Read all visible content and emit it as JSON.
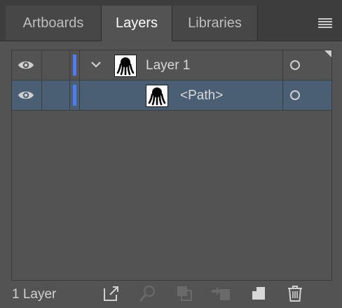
{
  "tabs": [
    {
      "label": "Artboards",
      "active": false
    },
    {
      "label": "Layers",
      "active": true
    },
    {
      "label": "Libraries",
      "active": false
    }
  ],
  "panel_menu_icon": "hamburger-menu-icon",
  "layers": [
    {
      "name": "Layer 1",
      "expanded": true,
      "visible": true,
      "color": "#4f7cf0",
      "thumbnail": "octopus-thumbnail"
    },
    {
      "name": "<Path>",
      "visible": true,
      "color": "#4f7cf0",
      "thumbnail": "octopus-thumbnail",
      "selected": true
    }
  ],
  "footer": {
    "count_label": "1 Layer",
    "icons": [
      "export-icon",
      "search-icon",
      "clipping-mask-icon",
      "move-to-layer-icon",
      "new-layer-icon",
      "delete-icon"
    ]
  },
  "colors": {
    "panel_bg": "#535353",
    "tabbar_bg": "#3d3d3d",
    "selected_row": "#4b5f74",
    "layer_color": "#4f7cf0"
  }
}
